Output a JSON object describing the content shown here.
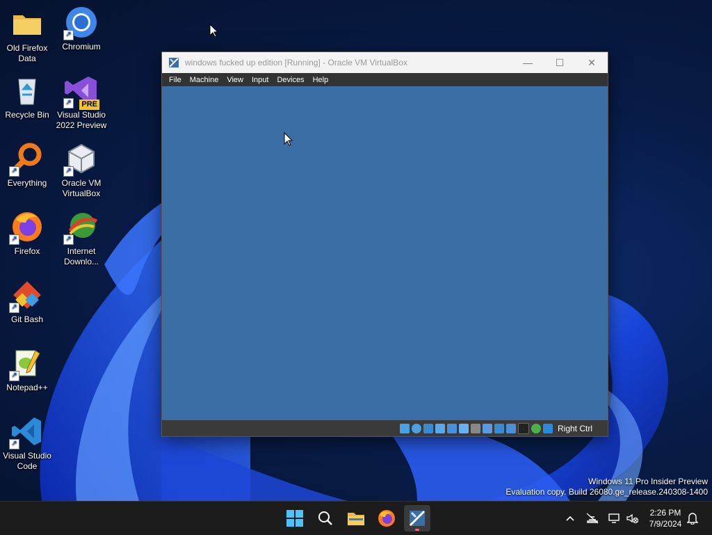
{
  "desktop": {
    "icons": [
      {
        "label": "Old Firefox Data"
      },
      {
        "label": "Chromium"
      },
      {
        "label": "Recycle Bin"
      },
      {
        "label": "Visual Studio 2022 Preview",
        "badge": "PRE"
      },
      {
        "label": "Everything"
      },
      {
        "label": "Oracle VM VirtualBox"
      },
      {
        "label": "Firefox"
      },
      {
        "label": "Internet Downlo..."
      },
      {
        "label": "Git Bash"
      },
      {
        "label": "Notepad++"
      },
      {
        "label": "Visual Studio Code"
      }
    ],
    "watermark": {
      "line1": "Windows 11 Pro Insider Preview",
      "line2": "Evaluation copy. Build 26080.ge_release.240308-1400"
    }
  },
  "vbox_window": {
    "title": "windows fucked up edition [Running] - Oracle VM VirtualBox",
    "menu": [
      "File",
      "Machine",
      "View",
      "Input",
      "Devices",
      "Help"
    ],
    "screen_color": "#3a6ea5",
    "status": {
      "host_key": "Right Ctrl",
      "indicators": [
        "hard-disk-icon",
        "optical-drive-icon",
        "floppy-icon",
        "audio-icon",
        "network-icon",
        "usb-icon",
        "shared-folders-icon",
        "display-icon",
        "video-capture-icon",
        "vrde-icon",
        "virtualization-icon",
        "cpu-icon",
        "mouse-integration-icon",
        "keyboard-capture-icon"
      ]
    }
  },
  "taskbar": {
    "apps": [
      "start-button",
      "search-button",
      "file-explorer",
      "firefox",
      "virtualbox"
    ],
    "active_app": "virtualbox",
    "tray": [
      "show-hidden-icons",
      "network-icon",
      "display-icon",
      "volume-icon",
      "notifications-icon"
    ],
    "time": "2:26 PM",
    "date": "7/9/2024"
  }
}
